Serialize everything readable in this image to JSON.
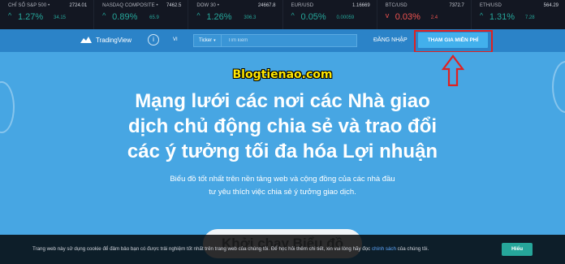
{
  "ticker": [
    {
      "name": "CHỈ SỐ S&P 500 •",
      "value": "2724.01",
      "arrow": "^",
      "percent": "1.27%",
      "change": "34.15",
      "direction": "up"
    },
    {
      "name": "NASDAQ COMPOSITE •",
      "value": "7462.5",
      "arrow": "^",
      "percent": "0.89%",
      "change": "65.9",
      "direction": "up"
    },
    {
      "name": "DOW 30 •",
      "value": "24667.8",
      "arrow": "^",
      "percent": "1.26%",
      "change": "306.3",
      "direction": "up"
    },
    {
      "name": "EUR/USD",
      "value": "1.16669",
      "arrow": "^",
      "percent": "0.05%",
      "change": "0.00059",
      "direction": "up"
    },
    {
      "name": "BTC/USD",
      "value": "7372.7",
      "arrow": "v",
      "percent": "0.03%",
      "change": "2.4",
      "direction": "down"
    },
    {
      "name": "ETH/USD",
      "value": "564.29",
      "arrow": "^",
      "percent": "1.31%",
      "change": "7.28",
      "direction": "up"
    }
  ],
  "nav": {
    "logo_text": "TradingView",
    "lang": "VI",
    "search_label": "Ticker",
    "search_placeholder": "Tìm kiếm",
    "login": "ĐĂNG NHẬP",
    "signup": "THAM GIA MIỄN PHÍ"
  },
  "hero": {
    "watermark": "Blogtienao.com",
    "headline_lines": [
      "Mạng lưới các  nơi các Nhà giao",
      "dịch chủ động chia sẻ và trao đổi",
      "các ý tưởng  tối đa hóa  Lợi nhuận"
    ],
    "sub_lines": [
      "Biểu đồ tốt nhất trên  nền tảng web và  cộng đồng của các nhà đầu",
      "tư yêu thích việc chia sẻ ý tưởng giao dịch."
    ],
    "launch_button": "Khởi chạy Biểu đồ"
  },
  "cookie": {
    "message": "Trang web này sử dụng cookie để đảm bảo bạn có được trải nghiệm tốt nhất trên trang web của chúng tôi. Để học hỏi thêm chi tiết, xin vui lòng hãy đọc",
    "policy_link": "chính sách",
    "message_end": "của chúng tôi.",
    "ok_button": "Hiểu"
  },
  "colors": {
    "up": "#26a69a",
    "down": "#ef5350",
    "nav": "#2b83c8",
    "hero": "#47a6e3",
    "highlight": "#e02020"
  }
}
